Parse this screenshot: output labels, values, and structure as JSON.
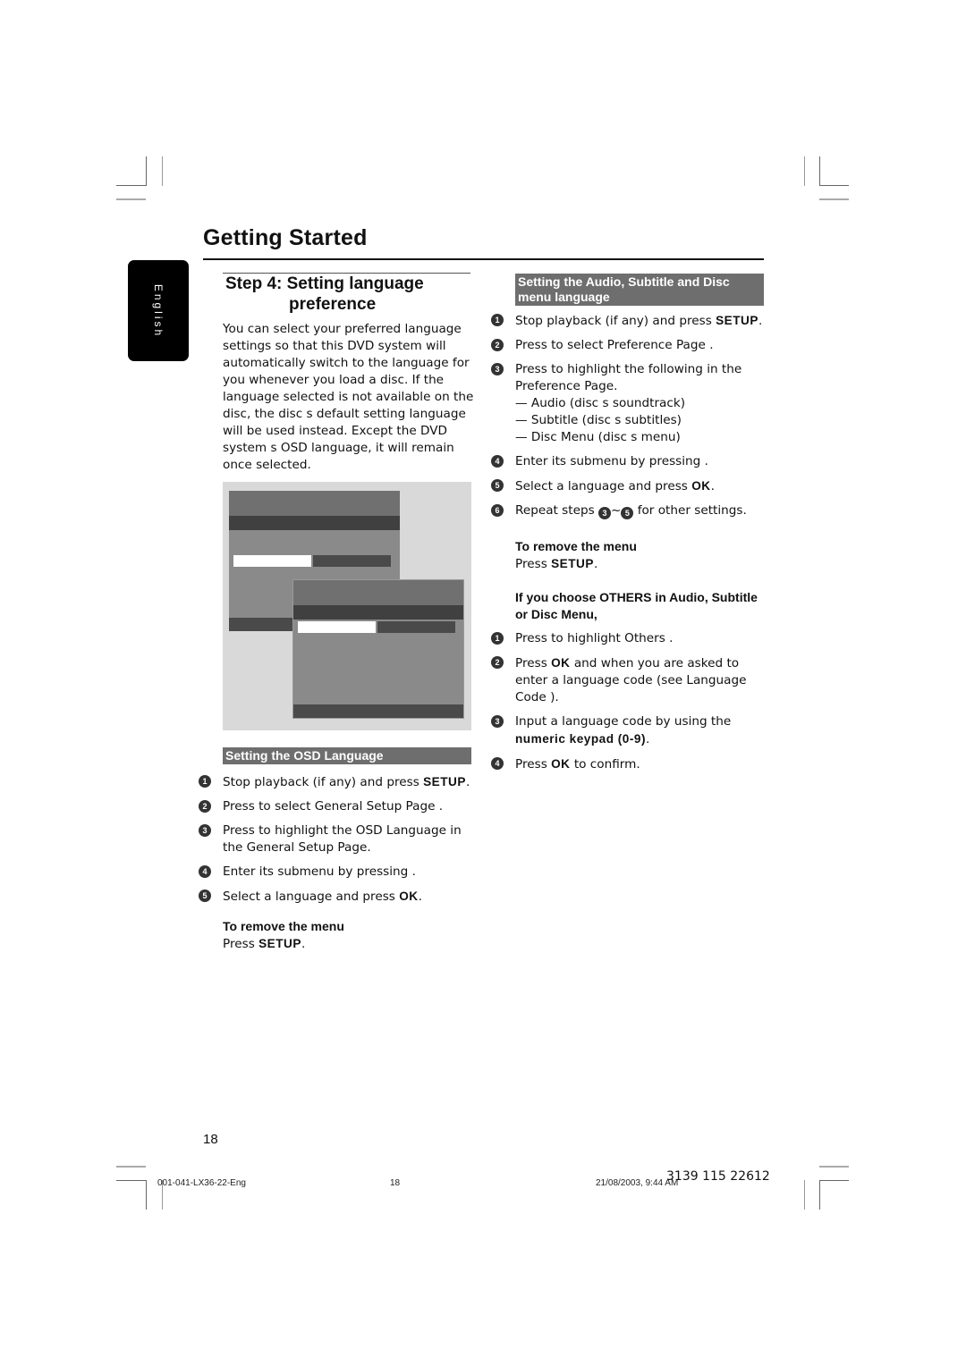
{
  "header": {
    "section_title": "Getting Started",
    "language_tab": "English"
  },
  "step": {
    "title_line1": "Step 4: Setting language",
    "title_line2": "preference",
    "intro": "You can select your preferred language settings so that this DVD system will automatically switch to the language for you whenever you load a disc.  If the language selected is not available on the disc, the disc s default setting language will be used instead.  Except the DVD system s OSD language, it will remain once selected."
  },
  "figure": {
    "description": "on-screen-menu-illustration"
  },
  "osd_section": {
    "heading": "Setting the OSD Language",
    "steps": [
      {
        "n": "1",
        "pre": "Stop playback (if any) and press ",
        "key": "SETUP",
        "post": "."
      },
      {
        "n": "2",
        "pre": "Press    to select  General Setup Page .",
        "key": "",
        "post": ""
      },
      {
        "n": "3",
        "pre": "Press         to highlight the  OSD Language  in the General Setup Page.",
        "key": "",
        "post": ""
      },
      {
        "n": "4",
        "pre": "Enter its submenu by pressing    .",
        "key": "",
        "post": ""
      },
      {
        "n": "5",
        "pre": "Select a language and press ",
        "key": "OK",
        "post": "."
      }
    ],
    "remove_title": "To remove the menu",
    "remove_pre": "Press ",
    "remove_key": "SETUP",
    "remove_post": "."
  },
  "audio_section": {
    "heading": "Setting the Audio, Subtitle and Disc menu language",
    "steps": [
      {
        "n": "1",
        "pre": "Stop playback (if any) and press ",
        "key": "SETUP",
        "post": "."
      },
      {
        "n": "2",
        "pre": "Press    to select  Preference Page .",
        "key": "",
        "post": ""
      },
      {
        "n": "3",
        "pre": "Press         to highlight the following in the Preference Page.",
        "key": "",
        "post": ""
      },
      {
        "n": "4",
        "pre": "Enter its submenu by pressing    .",
        "key": "",
        "post": ""
      },
      {
        "n": "5",
        "pre": "Select a language and press ",
        "key": "OK",
        "post": "."
      },
      {
        "n": "6",
        "pre": "Repeat steps ",
        "key": "",
        "post": " for other settings."
      }
    ],
    "sub_items": [
      "— Audio  (disc s soundtrack)",
      "— Subtitle  (disc s subtitles)",
      "— Disc Menu  (disc s menu)"
    ],
    "repeat_from": "3",
    "repeat_to": "5",
    "repeat_sep": "~",
    "remove_title": "To remove the menu",
    "remove_pre": "Press ",
    "remove_key": "SETUP",
    "remove_post": "."
  },
  "others_section": {
    "heading": "If you choose OTHERS in Audio, Subtitle or Disc Menu,",
    "steps": [
      {
        "n": "1",
        "pre": "Press         to highlight  Others .",
        "key": "",
        "post": ""
      },
      {
        "n": "2",
        "pre": "Press ",
        "key": "OK",
        "post": " and when you are asked to enter a language code (see  Language Code )."
      },
      {
        "n": "3",
        "pre": "Input a language code by using the ",
        "key": "numeric keypad (0-9)",
        "post": "."
      },
      {
        "n": "4",
        "pre": "Press ",
        "key": "OK",
        "post": " to confirm."
      }
    ]
  },
  "footer": {
    "page_number": "18",
    "file_code": "001-041-LX36-22-Eng",
    "sheet_number": "18",
    "date_time": "21/08/2003, 9:44 AM",
    "part_number": "3139 115 22612"
  }
}
